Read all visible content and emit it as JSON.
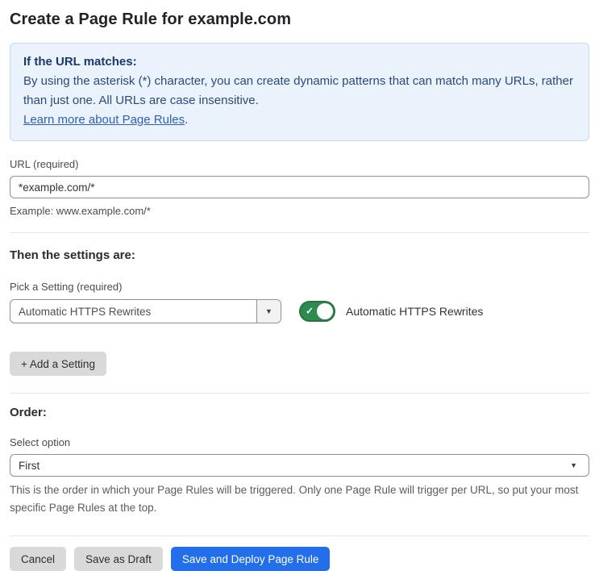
{
  "page": {
    "title": "Create a Page Rule for example.com"
  },
  "info_box": {
    "heading": "If the URL matches:",
    "body": "By using the asterisk (*) character, you can create dynamic patterns that can match many URLs, rather than just one. All URLs are case insensitive.",
    "link_label": "Learn more about Page Rules",
    "link_suffix": "."
  },
  "url_field": {
    "label": "URL (required)",
    "value": "*example.com/*",
    "helper": "Example: www.example.com/*"
  },
  "settings_section": {
    "heading": "Then the settings are:",
    "picker_label": "Pick a Setting (required)",
    "picker_value": "Automatic HTTPS Rewrites",
    "picker_caret": "▼",
    "toggle_state": "on",
    "toggle_check": "✓",
    "toggle_label": "Automatic HTTPS Rewrites",
    "add_setting_label": "+ Add a Setting"
  },
  "order_section": {
    "heading": "Order:",
    "select_label": "Select option",
    "select_value": "First",
    "select_caret": "▼",
    "helper": "This is the order in which your Page Rules will be triggered. Only one Page Rule will trigger per URL, so put your most specific Page Rules at the top."
  },
  "footer": {
    "cancel_label": "Cancel",
    "save_draft_label": "Save as Draft",
    "save_deploy_label": "Save and Deploy Page Rule"
  },
  "colors": {
    "accent_blue": "#226eeb",
    "info_background": "#eaf2fc",
    "info_border": "#c5daf2",
    "info_heading_navy": "#1b3a6b",
    "info_body_navy": "#2b4a7d",
    "link_blue": "#2d5ec9",
    "toggle_green": "#2e8b4f",
    "gray_button": "#d9d9d9"
  }
}
